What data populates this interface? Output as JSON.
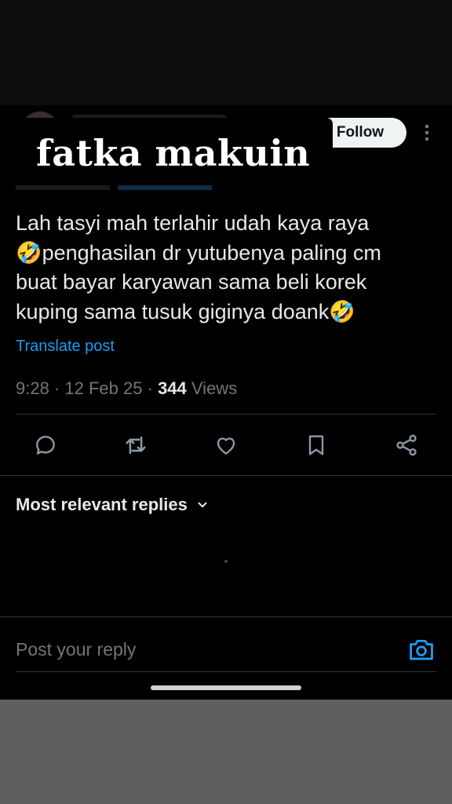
{
  "header": {
    "follow_label": "Follow"
  },
  "overlay": {
    "caption": "fatka makuin"
  },
  "tweet": {
    "text_lines": [
      "Lah tasyi mah terlahir udah kaya raya",
      "🤣penghasilan dr yutubenya paling cm",
      "buat bayar karyawan sama beli korek",
      "kuping sama tusuk giginya doank🤣"
    ],
    "translate_label": "Translate post",
    "time": "9:28",
    "date": "12 Feb 25",
    "views_count": "344",
    "views_label": "Views"
  },
  "actions": [
    {
      "name": "reply-icon"
    },
    {
      "name": "repost-icon"
    },
    {
      "name": "like-icon"
    },
    {
      "name": "bookmark-icon"
    },
    {
      "name": "share-icon"
    }
  ],
  "replies": {
    "sort_label": "Most relevant replies"
  },
  "composer": {
    "placeholder": "Post your reply"
  },
  "colors": {
    "background": "#000000",
    "text": "#e7e9ea",
    "muted": "#71767b",
    "link": "#1d9bf0",
    "divider": "#2f3336"
  }
}
